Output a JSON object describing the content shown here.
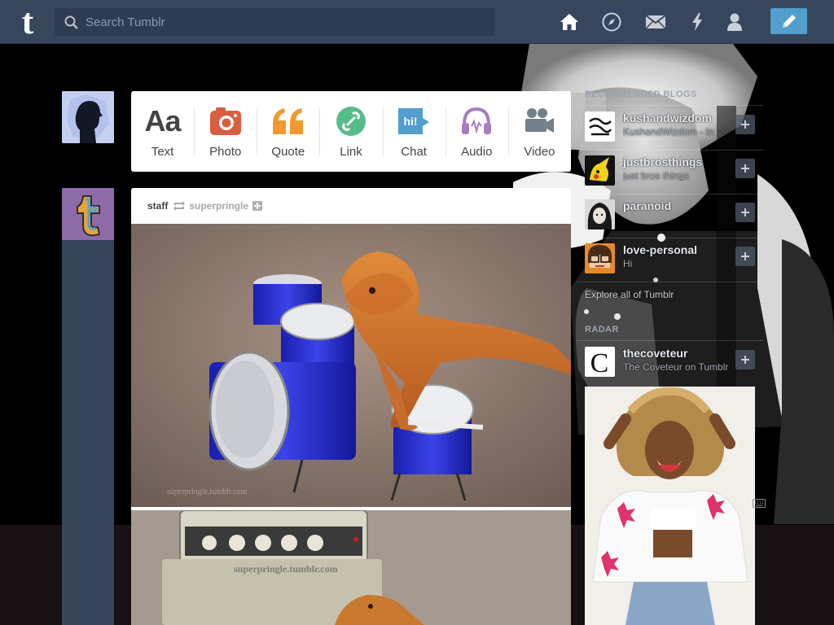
{
  "header": {
    "logo": "t",
    "search_placeholder": "Search Tumblr",
    "nav": [
      "home-icon",
      "explore-compass-icon",
      "inbox-mail-icon",
      "activity-lightning-icon",
      "account-person-icon"
    ],
    "compose_icon": "pencil-icon"
  },
  "post_types": [
    {
      "label": "Text",
      "icon": "text-aa-icon",
      "color": "#444444"
    },
    {
      "label": "Photo",
      "icon": "camera-icon",
      "color": "#d95e40"
    },
    {
      "label": "Quote",
      "icon": "quote-icon",
      "color": "#f2992e"
    },
    {
      "label": "Link",
      "icon": "link-icon",
      "color": "#56bc8a"
    },
    {
      "label": "Chat",
      "icon": "chat-icon",
      "color": "#529ecc"
    },
    {
      "label": "Audio",
      "icon": "headphones-icon",
      "color": "#a77dc2"
    },
    {
      "label": "Video",
      "icon": "video-camera-icon",
      "color": "#748089"
    }
  ],
  "text_icon_glyph": "Aa",
  "chat_icon_glyph": "hi!",
  "post": {
    "author": "staff",
    "reblog_icon": "reblog-icon",
    "source": "superpringle",
    "watermark_1": "superpringle.tumblr.com",
    "watermark_2": "superpringle.tumblr.com"
  },
  "sidebar": {
    "recommended_title": "RECOMMENDED BLOGS",
    "blogs": [
      {
        "name": "kushandwizdom",
        "desc": "KushandWizdom - In"
      },
      {
        "name": "justbrosthings",
        "desc": "just bros things"
      },
      {
        "name": "paranoid",
        "desc": ""
      },
      {
        "name": "love-personal",
        "desc": "Hi"
      }
    ],
    "explore": "Explore all of Tumblr",
    "radar_title": "RADAR",
    "radar_blog": {
      "name": "thecoveteur",
      "desc": "The Coveteur on Tumblr"
    }
  },
  "colors": {
    "header": "#36465d",
    "accent": "#529ecc"
  }
}
